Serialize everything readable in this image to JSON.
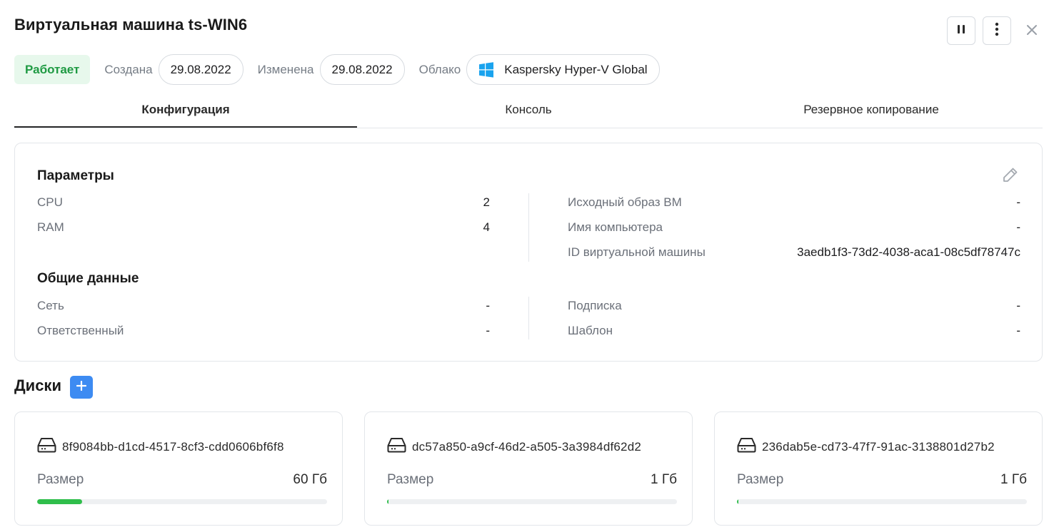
{
  "header": {
    "title": "Виртуальная машина ts-WIN6",
    "pause_icon": "pause-icon",
    "more_icon": "more-vertical-icon",
    "close_icon": "close-icon"
  },
  "meta": {
    "status": "Работает",
    "created_label": "Создана",
    "created_value": "29.08.2022",
    "modified_label": "Изменена",
    "modified_value": "29.08.2022",
    "cloud_label": "Облако",
    "cloud_value": "Kaspersky Hyper-V Global",
    "cloud_icon": "windows-logo-icon"
  },
  "tabs": [
    {
      "label": "Конфигурация",
      "active": true
    },
    {
      "label": "Консоль",
      "active": false
    },
    {
      "label": "Резервное копирование",
      "active": false
    }
  ],
  "params": {
    "title": "Параметры",
    "left": [
      {
        "key": "CPU",
        "value": "2"
      },
      {
        "key": "RAM",
        "value": "4"
      }
    ],
    "right": [
      {
        "key": "Исходный образ ВМ",
        "value": "-"
      },
      {
        "key": "Имя компьютера",
        "value": "-"
      },
      {
        "key": "ID виртуальной машины",
        "value": "3aedb1f3-73d2-4038-aca1-08c5df78747c"
      }
    ]
  },
  "general": {
    "title": "Общие данные",
    "left": [
      {
        "key": "Сеть",
        "value": "-"
      },
      {
        "key": "Ответственный",
        "value": "-"
      }
    ],
    "right": [
      {
        "key": "Подписка",
        "value": "-"
      },
      {
        "key": "Шаблон",
        "value": "-"
      }
    ]
  },
  "disks": {
    "title": "Диски",
    "add_label": "+",
    "items": [
      {
        "id": "8f9084bb-d1cd-4517-8cf3-cdd0606bf6f8",
        "size_label": "Размер",
        "size_value": "60 Гб",
        "usage_fraction": 0.155
      },
      {
        "id": "dc57a850-a9cf-46d2-a505-3a3984df62d2",
        "size_label": "Размер",
        "size_value": "1 Гб",
        "usage_fraction": 0.005
      },
      {
        "id": "236dab5e-cd73-47f7-91ac-3138801d27b2",
        "size_label": "Размер",
        "size_value": "1 Гб",
        "usage_fraction": 0.005
      }
    ]
  },
  "colors": {
    "status_bg": "#e7f8ec",
    "status_text": "#1f9a43",
    "accent": "#3d8bf2",
    "usage_bar": "#2fbe4b"
  }
}
